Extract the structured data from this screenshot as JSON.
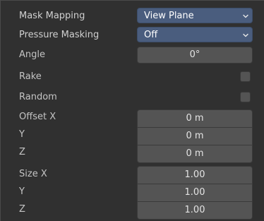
{
  "mask_mapping": {
    "label": "Mask Mapping",
    "value": "View Plane"
  },
  "pressure_masking": {
    "label": "Pressure Masking",
    "value": "Off"
  },
  "angle": {
    "label": "Angle",
    "value": "0°"
  },
  "rake": {
    "label": "Rake",
    "checked": false
  },
  "random": {
    "label": "Random",
    "checked": false
  },
  "offset": {
    "label_x": "Offset X",
    "label_y": "Y",
    "label_z": "Z",
    "x": "0 m",
    "y": "0 m",
    "z": "0 m"
  },
  "size": {
    "label_x": "Size X",
    "label_y": "Y",
    "label_z": "Z",
    "x": "1.00",
    "y": "1.00",
    "z": "1.00"
  },
  "icons": {
    "dropdown": "chevron-down-icon"
  },
  "colors": {
    "panel_bg": "#303030",
    "dropdown_bg": "#4a5d7e",
    "field_bg": "#545454",
    "text": "#d0d0d0"
  }
}
